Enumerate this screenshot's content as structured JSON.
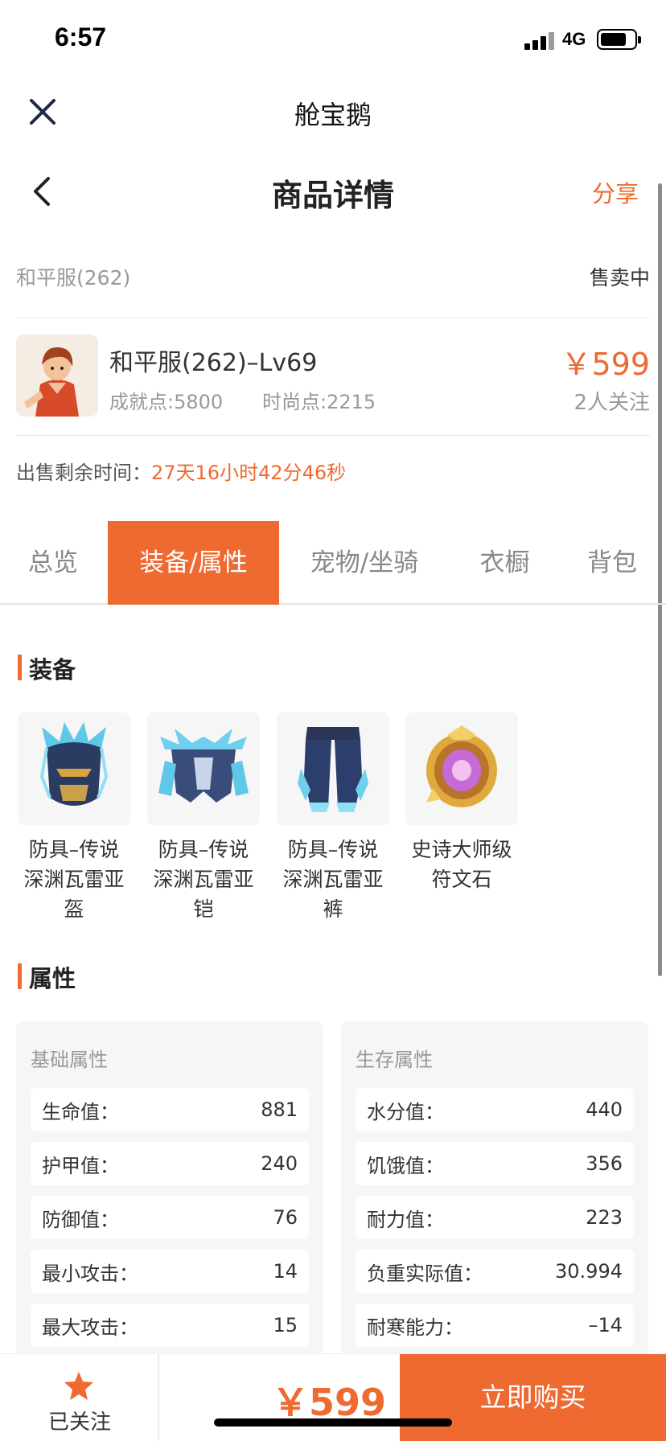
{
  "status_bar": {
    "time": "6:57",
    "network": "4G",
    "battery_level": 0.78
  },
  "miniprogram": {
    "title": "舱宝鹅"
  },
  "header": {
    "title": "商品详情",
    "share_label": "分享"
  },
  "listing": {
    "server": "和平服(262)",
    "status": "售卖中",
    "name": "和平服(262)–Lv69",
    "achievement": "成就点:5800",
    "fashion": "时尚点:2215",
    "price": "￥599",
    "followers": "2人关注",
    "remain_label": "出售剩余时间：",
    "remain_value": "27天16小时42分46秒"
  },
  "tabs": [
    {
      "label": "总览"
    },
    {
      "label": "装备/属性",
      "active": true
    },
    {
      "label": "宠物/坐骑"
    },
    {
      "label": "衣橱"
    },
    {
      "label": "背包"
    }
  ],
  "equipment": {
    "title": "装备",
    "items": [
      {
        "icon": "helmet-icon",
        "line1": "防具–传说",
        "line2": "深渊瓦雷亚",
        "line3": "盔"
      },
      {
        "icon": "armor-icon",
        "line1": "防具–传说",
        "line2": "深渊瓦雷亚",
        "line3": "铠"
      },
      {
        "icon": "pants-icon",
        "line1": "防具–传说",
        "line2": "深渊瓦雷亚",
        "line3": "裤"
      },
      {
        "icon": "rune-stone-icon",
        "line1": "史诗大师级",
        "line2": "符文石",
        "line3": ""
      }
    ]
  },
  "attributes": {
    "title": "属性",
    "basic": {
      "title": "基础属性",
      "rows": [
        {
          "label": "生命值：",
          "value": "881"
        },
        {
          "label": "护甲值：",
          "value": "240"
        },
        {
          "label": "防御值：",
          "value": "76"
        },
        {
          "label": "最小攻击：",
          "value": "14"
        },
        {
          "label": "最大攻击：",
          "value": "15"
        }
      ]
    },
    "survival": {
      "title": "生存属性",
      "rows": [
        {
          "label": "水分值：",
          "value": "440"
        },
        {
          "label": "饥饿值：",
          "value": "356"
        },
        {
          "label": "耐力值：",
          "value": "223"
        },
        {
          "label": "负重实际值：",
          "value": "30.994"
        },
        {
          "label": "耐寒能力：",
          "value": "–14"
        }
      ]
    }
  },
  "bottom_bar": {
    "follow_label": "已关注",
    "price": "￥599",
    "buy_label": "立即购买"
  },
  "colors": {
    "accent": "#ee6a31",
    "card_bg": "#f6f6f6",
    "muted_text": "#999999"
  }
}
